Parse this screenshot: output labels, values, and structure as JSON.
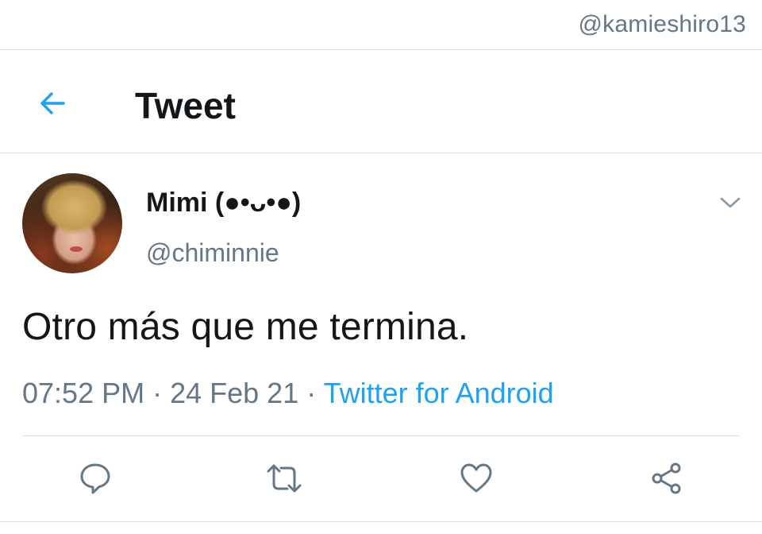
{
  "watermark": "@kamieshiro13",
  "header": {
    "title": "Tweet",
    "back_icon": "arrow-left-icon"
  },
  "tweet": {
    "display_name": "Mimi (●•ᴗ•●)",
    "handle": "@chiminnie",
    "text": "Otro más que me termina.",
    "time": "07:52 PM",
    "separator": " · ",
    "date": "24 Feb 21",
    "source": "Twitter for Android"
  },
  "actions": [
    {
      "name": "reply",
      "icon": "reply-icon"
    },
    {
      "name": "retweet",
      "icon": "retweet-icon"
    },
    {
      "name": "like",
      "icon": "heart-icon"
    },
    {
      "name": "share",
      "icon": "share-icon"
    }
  ],
  "colors": {
    "accent": "#1da1f2",
    "text": "#14171a",
    "secondary": "#657786",
    "divider": "#d8dee4",
    "icon": "#657786"
  }
}
